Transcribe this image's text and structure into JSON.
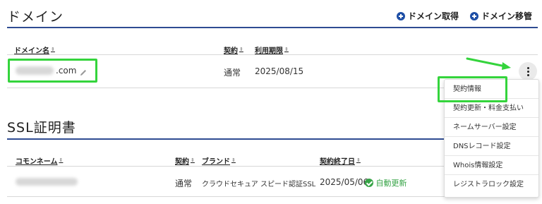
{
  "domain_section": {
    "title": "ドメイン",
    "actions": [
      {
        "label": "ドメイン取得",
        "icon": "plus-circle-icon"
      },
      {
        "label": "ドメイン移管",
        "icon": "plus-circle-icon"
      }
    ],
    "columns": [
      "ドメイン名",
      "契約",
      "利用期限"
    ],
    "row": {
      "domain_suffix": ".com",
      "contract": "通常",
      "expiry": "2025/08/15"
    }
  },
  "ssl_section": {
    "title": "SSL証明書",
    "columns": [
      "コモンネーム",
      "契約",
      "ブランド",
      "契約終了日"
    ],
    "row": {
      "contract": "通常",
      "brand": "クラウドセキュア スピード認証SSL",
      "end_date": "2025/05/06",
      "auto_renew": "自動更新"
    }
  },
  "menu": {
    "items": [
      "契約情報",
      "契約更新・料金支払い",
      "ネームサーバー設定",
      "DNSレコード設定",
      "Whois情報設定",
      "レジストラロック設定"
    ]
  },
  "colors": {
    "accent": "#1e4fa6",
    "rule": "#2f4c92",
    "highlight": "#34d43c",
    "success": "#37a447"
  }
}
